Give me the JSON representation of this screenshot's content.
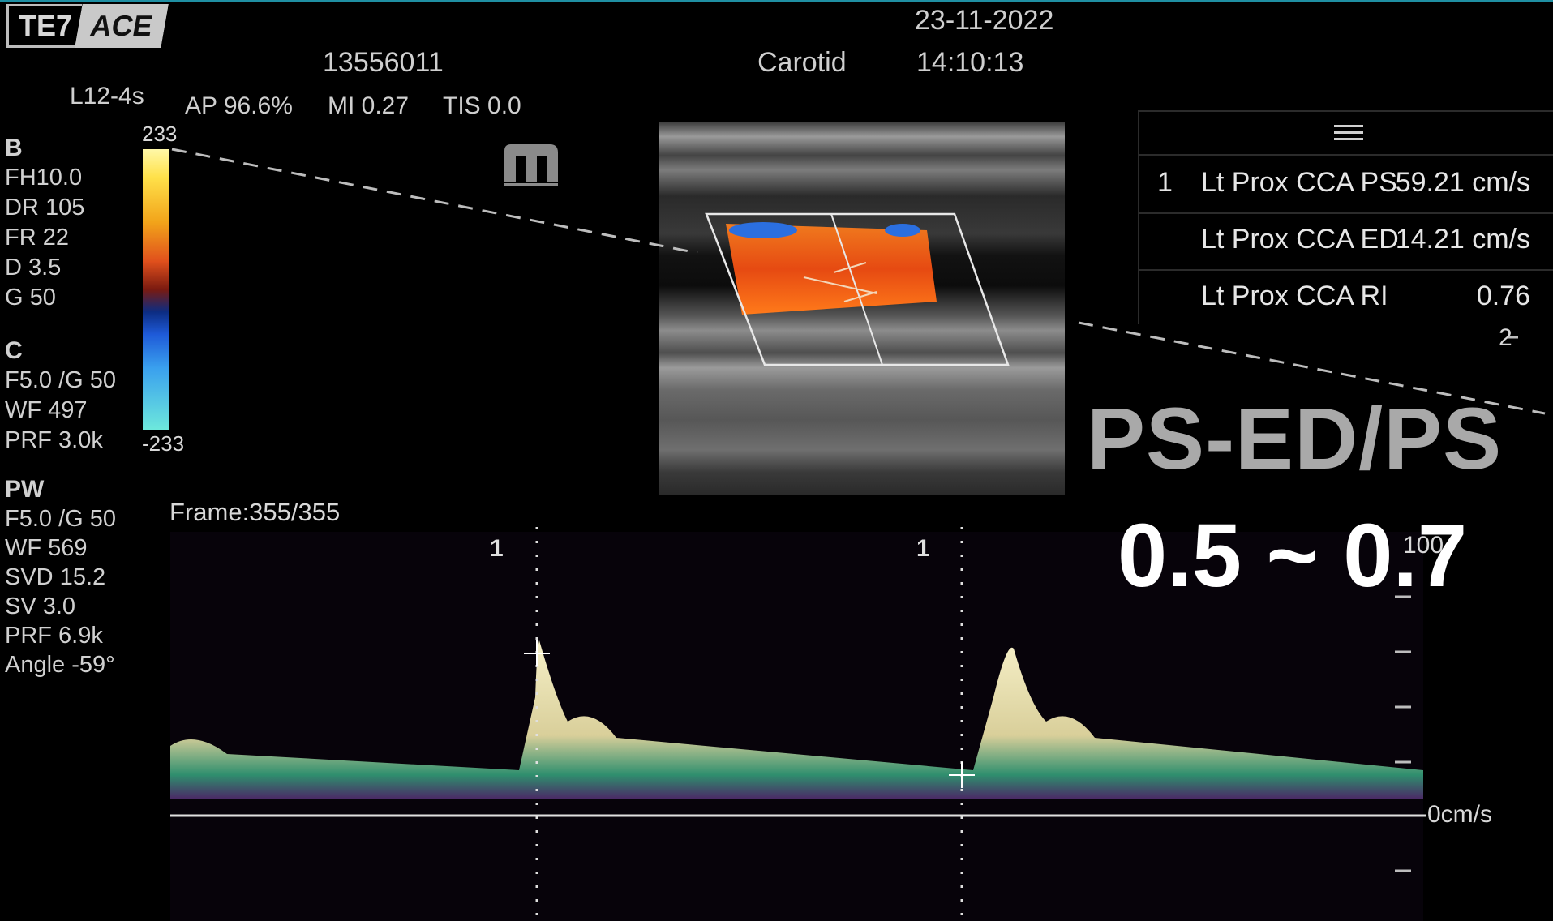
{
  "header": {
    "brand_left": "TE7",
    "brand_right": "ACE",
    "patient_id": "13556011",
    "exam": "Carotid",
    "date": "23-11-2022",
    "time": "14:10:13",
    "probe": "L12-4s",
    "acoustic": {
      "ap": "AP 96.6%",
      "mi": "MI 0.27",
      "tis": "TIS 0.0"
    }
  },
  "params": {
    "b_title": "B",
    "b_items": [
      "FH10.0",
      "DR 105",
      "FR 22",
      "D 3.5",
      "G 50"
    ],
    "c_title": "C",
    "c_items": [
      "F5.0  /G 50",
      "WF 497",
      "PRF 3.0k"
    ],
    "pw_title": "PW",
    "pw_items": [
      "F5.0  /G 50",
      "WF 569",
      "SVD 15.2",
      "SV 3.0",
      "PRF 6.9k",
      "Angle  -59°"
    ]
  },
  "colorbar": {
    "top_label": "233",
    "bottom_label": "-233"
  },
  "measurements": {
    "menu_icon": "hamburger-menu-icon",
    "rows": [
      {
        "num": "1",
        "label": "Lt Prox CCA PS",
        "value": "59.21 cm/s"
      },
      {
        "num": "",
        "label": "Lt Prox CCA ED",
        "value": "14.21 cm/s"
      },
      {
        "num": "",
        "label": "Lt Prox CCA RI",
        "value": "0.76"
      }
    ]
  },
  "overlay": {
    "formula": "PS-ED/PS",
    "range": "0.5 ~ 0.7"
  },
  "spectral": {
    "frame": "Frame:355/355",
    "marker1": "1",
    "marker2": "1",
    "baseline_label": "0cm/s",
    "scale_top": "100",
    "scale_side": "2"
  },
  "colors": {
    "accent": "#1f8fa3",
    "flow_red": "#e85a1a",
    "flow_blue": "#2b6fe0",
    "overlay_gray": "#a9a9a9"
  }
}
